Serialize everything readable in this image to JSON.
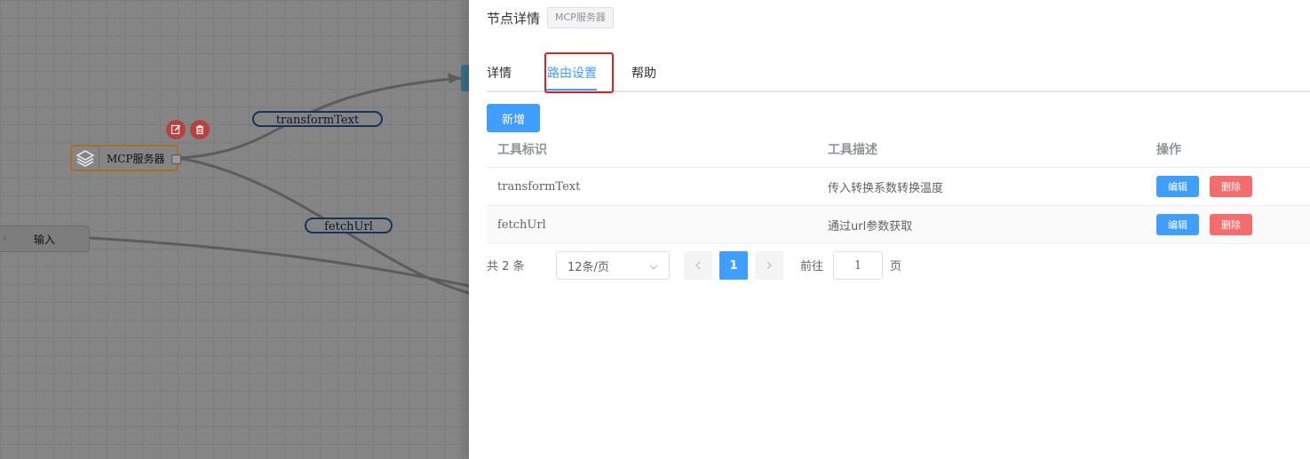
{
  "canvas": {
    "mcp_node_label": "MCP服务器",
    "input_node_label": "输入",
    "edge_labels": {
      "transform": "transformText",
      "fetch": "fetchUrl"
    }
  },
  "drawer": {
    "title": "节点详情",
    "tag": "MCP服务器",
    "tabs": [
      {
        "label": "详情"
      },
      {
        "label": "路由设置"
      },
      {
        "label": "帮助"
      }
    ],
    "add_button": "新增",
    "table": {
      "headers": [
        "工具标识",
        "工具描述",
        "操作"
      ],
      "rows": [
        {
          "id": "transformText",
          "desc": "传入转换系数转换温度"
        },
        {
          "id": "fetchUrl",
          "desc": "通过url参数获取"
        }
      ],
      "edit_label": "编辑",
      "delete_label": "删除"
    },
    "pagination": {
      "total_text": "共 2 条",
      "page_size": "12条/页",
      "current_page": "1",
      "goto_label": "前往",
      "goto_value": "1",
      "page_unit": "页"
    }
  },
  "colors": {
    "primary": "#409eff",
    "danger": "#f56c6c",
    "highlight": "#e02020"
  }
}
